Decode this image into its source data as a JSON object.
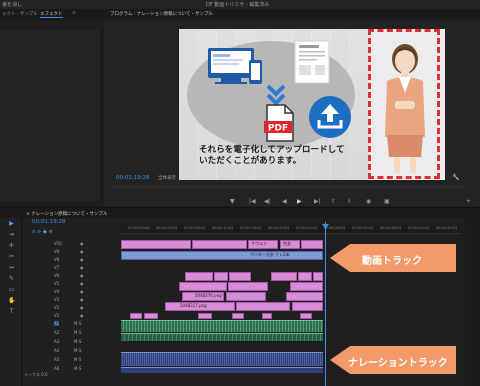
{
  "window": {
    "title": "DF 動画トリミサ - 編集済み",
    "left_label": "番を消し"
  },
  "workspace": {
    "tabs": [
      "ェクト : サンプル",
      "エフェクト",
      "エフェクトコントロール"
    ],
    "active_tab": "エフェクト"
  },
  "program": {
    "tab_label": "プログラム : ナレーション原稿について・サンプル",
    "caption_line1": "それらを電子化してアップロードして",
    "caption_line2": "いただくことがあります。",
    "timecode": "00;01;19;28",
    "fit_label": "全体表示",
    "colors": {
      "pdf_red": "#e0262b",
      "upload_blue": "#1c6fc0",
      "chevron_blue": "#2d7bd8",
      "dash_red": "#e03030"
    }
  },
  "timeline": {
    "tab_label": "ナレーション原稿について・サンプル",
    "timecode": "00;01;19;28",
    "ruler_ticks": [
      "00;01;00;00",
      "00;01;04;02",
      "00;01;08;02",
      "00;01;12;02",
      "00;01;16;02",
      "00;01;20;02",
      "00;01;24;02",
      "00;01;28;02",
      "00;01;32;02",
      "00;01;36;02",
      "00;01;40;02",
      "00;01;44;02"
    ],
    "video_tracks": [
      "V10",
      "V9",
      "V8",
      "V7",
      "V6",
      "V5",
      "V4",
      "V3",
      "V2",
      "V1"
    ],
    "audio_tracks": [
      "A1",
      "A2",
      "A3",
      "A4",
      "A5",
      "A6"
    ],
    "mix_label": "ミックス",
    "mix_value": "0.0",
    "clip_labels": {
      "v10_a": "サウルミ",
      "v10_b": "色女",
      "v9_a": "アバター方針 ナレ2本",
      "v5_a": "2048376.png",
      "v4_a": "2048317.png"
    }
  },
  "annotations": {
    "video_track": "動画トラック",
    "narration_track": "ナレーショントラック",
    "color": "#f39a6b"
  }
}
